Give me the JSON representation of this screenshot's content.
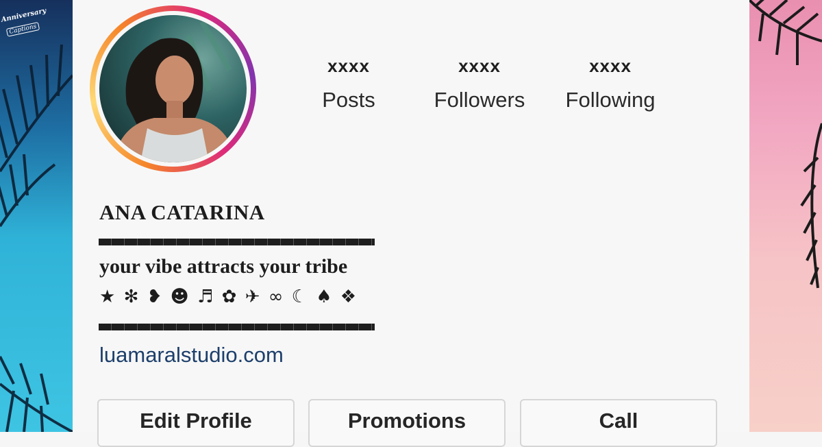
{
  "watermark": {
    "line1": "Anniversary",
    "line2": "Captions"
  },
  "profile": {
    "stats": [
      {
        "value": "xxxx",
        "label": "Posts"
      },
      {
        "value": "xxxx",
        "label": "Followers"
      },
      {
        "value": "xxxx",
        "label": "Following"
      }
    ],
    "name": "ANA CATARINA",
    "tagline": "your vibe attracts your tribe",
    "symbols": "★ ✻ ❥ ☻ ♬ ✿ ✈ ∞ ☾ ♠ ❖",
    "website": "luamaralstudio.com"
  },
  "actions": {
    "edit_profile": "Edit Profile",
    "promotions": "Promotions",
    "call": "Call"
  },
  "colors": {
    "link": "#1d3f6b",
    "ring_start": "#f58529",
    "ring_end": "#8134af"
  }
}
